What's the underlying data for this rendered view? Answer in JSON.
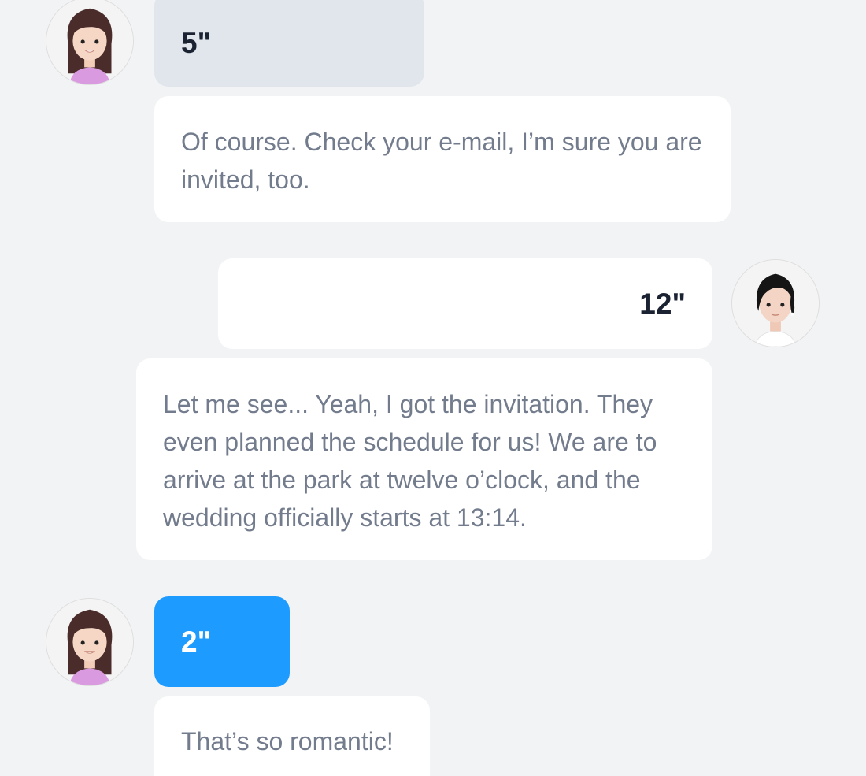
{
  "conversation": {
    "messages": [
      {
        "sender": "girl",
        "type": "voice",
        "duration": "5\"",
        "style": "grey"
      },
      {
        "sender": "girl",
        "type": "text",
        "text": "Of course. Check your e-mail, I’m sure you are invited, too."
      },
      {
        "sender": "woman",
        "type": "voice",
        "duration": "12\"",
        "style": "white"
      },
      {
        "sender": "woman",
        "type": "text",
        "text": "Let me see... Yeah, I got the invitation. They even planned the schedule for us! We are to arrive at the park at twelve o’clock, and the wedding officially starts at 13:14."
      },
      {
        "sender": "girl",
        "type": "voice",
        "duration": "2\"",
        "style": "blue"
      },
      {
        "sender": "girl",
        "type": "text",
        "text": "That’s so romantic!"
      }
    ]
  },
  "colors": {
    "background": "#f2f3f5",
    "voice_grey": "#e1e5ec",
    "voice_blue": "#1e9bff",
    "text_bubble": "#ffffff",
    "message_text": "#737c8d",
    "duration_text": "#1b2333"
  }
}
